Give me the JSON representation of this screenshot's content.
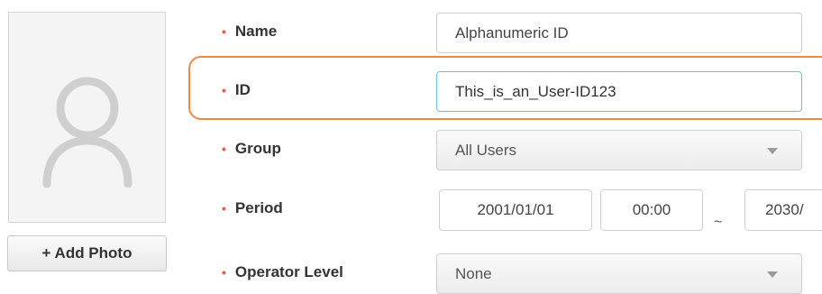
{
  "photo": {
    "add_label": "+ Add Photo"
  },
  "form": {
    "name": {
      "label": "Name",
      "value": "Alphanumeric ID"
    },
    "id": {
      "label": "ID",
      "value": "This_is_an_User-ID123"
    },
    "group": {
      "label": "Group",
      "selected": "All Users"
    },
    "period": {
      "label": "Period",
      "start_date": "2001/01/01",
      "start_time": "00:00",
      "separator": "~",
      "end_date": "2030/"
    },
    "operator_level": {
      "label": "Operator Level",
      "selected": "None"
    }
  },
  "colors": {
    "highlight": "#ed8a46",
    "focus_border": "#6cc3c6",
    "required_bullet": "#e05a4a"
  }
}
